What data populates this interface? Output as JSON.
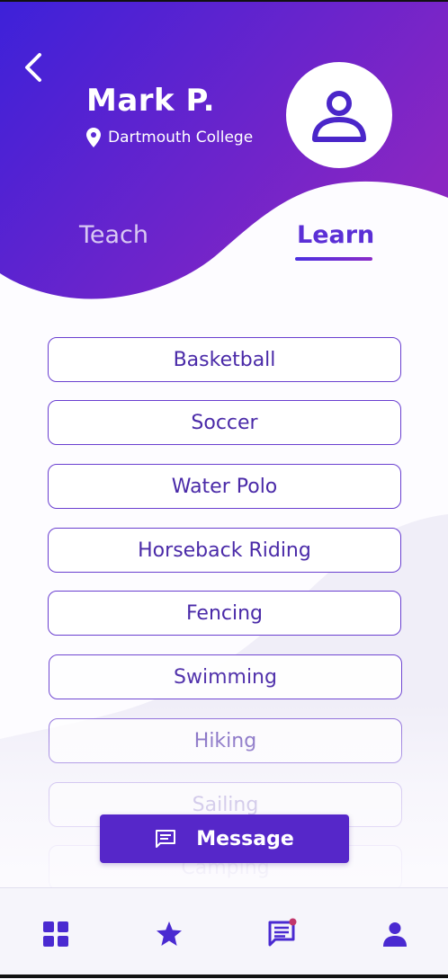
{
  "profile": {
    "name": "Mark P.",
    "location": "Dartmouth College"
  },
  "tabs": {
    "teach": "Teach",
    "learn": "Learn",
    "active": "Learn"
  },
  "skills": [
    "Basketball",
    "Soccer",
    "Water Polo",
    "Horseback Riding",
    "Fencing",
    "Swimming",
    "Hiking",
    "Sailing",
    "Camping"
  ],
  "message_button": {
    "label": "Message"
  },
  "bottom_nav": {
    "items": [
      "grid-icon",
      "star-icon",
      "chat-icon",
      "person-icon"
    ],
    "chat_has_notification": true
  },
  "colors": {
    "gradient_start": "#3d21d9",
    "gradient_end": "#8a26c2",
    "accent": "#5627c9",
    "item_border": "#6a3fd0",
    "item_text": "#4a2aa8",
    "notification_dot": "#c2366b"
  }
}
